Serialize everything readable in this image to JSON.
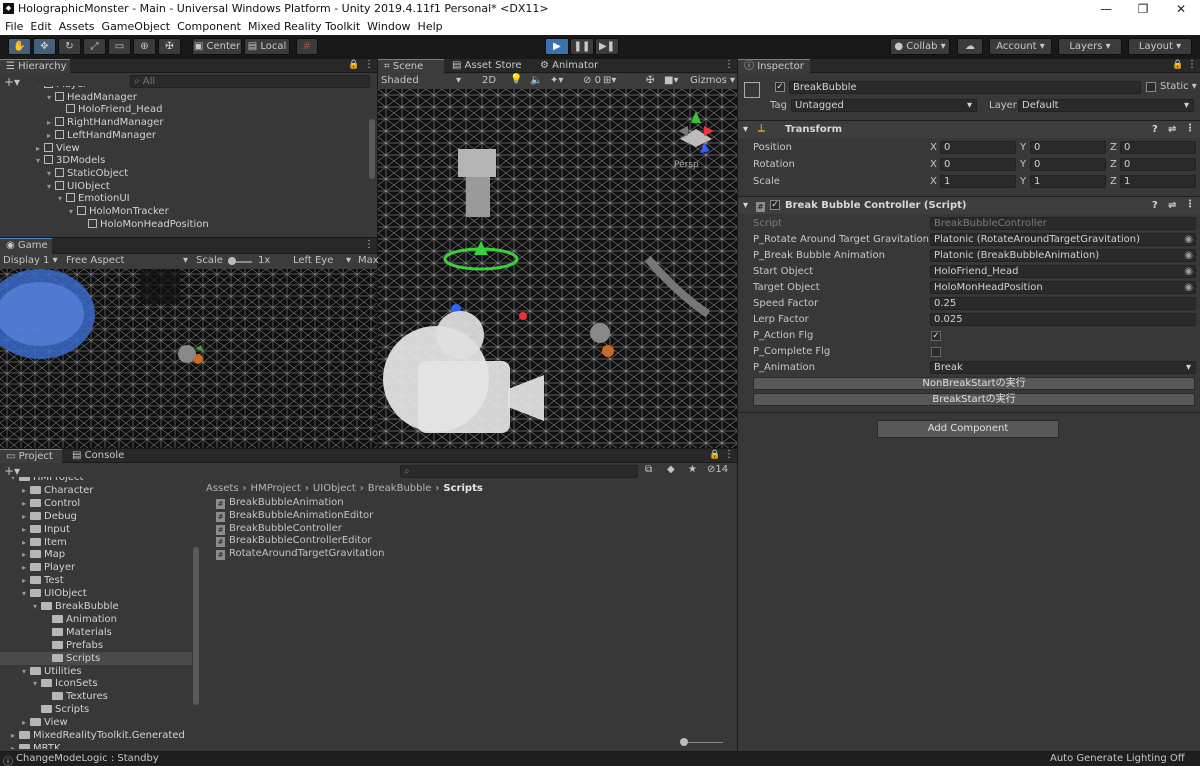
{
  "window": {
    "title": "HolographicMonster - Main - Universal Windows Platform - Unity 2019.4.11f1 Personal* <DX11>",
    "icon": "unity-icon"
  },
  "menu": [
    "File",
    "Edit",
    "Assets",
    "GameObject",
    "Component",
    "Mixed Reality Toolkit",
    "Window",
    "Help"
  ],
  "toolbar": {
    "center": "Center",
    "local": "Local",
    "collab": "Collab",
    "account": "Account",
    "layers": "Layers",
    "layout": "Layout"
  },
  "hierarchy": {
    "title": "Hierarchy",
    "search_placeholder": "All",
    "items": [
      {
        "label": "Player",
        "indent": 2
      },
      {
        "label": "HeadManager",
        "indent": 3
      },
      {
        "label": "HoloFriend_Head",
        "indent": 4
      },
      {
        "label": "RightHandManager",
        "indent": 3
      },
      {
        "label": "LeftHandManager",
        "indent": 3
      },
      {
        "label": "View",
        "indent": 2
      },
      {
        "label": "3DModels",
        "indent": 2
      },
      {
        "label": "StaticObject",
        "indent": 3
      },
      {
        "label": "UIObject",
        "indent": 3
      },
      {
        "label": "EmotionUI",
        "indent": 4
      },
      {
        "label": "HoloMonTracker",
        "indent": 5
      },
      {
        "label": "HoloMonHeadPosition",
        "indent": 6
      }
    ]
  },
  "game": {
    "title": "Game",
    "display": "Display 1",
    "aspect": "Free Aspect",
    "scale_label": "Scale",
    "scale_value": "1x",
    "eye": "Left Eye",
    "max": "Max"
  },
  "scene": {
    "tabs": [
      "Scene",
      "Asset Store",
      "Animator"
    ],
    "shading": "Shaded",
    "mode2d": "2D",
    "gizmos": "Gizmos",
    "persp": "Persp",
    "hidden_count": "0"
  },
  "project": {
    "tabs": [
      "Project",
      "Console"
    ],
    "hidden_count": "14",
    "breadcrumb": [
      "Assets",
      "HMProject",
      "UIObject",
      "BreakBubble",
      "Scripts"
    ],
    "tree": [
      {
        "label": "HMProject",
        "indent": 1
      },
      {
        "label": "Character",
        "indent": 2
      },
      {
        "label": "Control",
        "indent": 2
      },
      {
        "label": "Debug",
        "indent": 2
      },
      {
        "label": "Input",
        "indent": 2
      },
      {
        "label": "Item",
        "indent": 2
      },
      {
        "label": "Map",
        "indent": 2
      },
      {
        "label": "Player",
        "indent": 2
      },
      {
        "label": "Test",
        "indent": 2
      },
      {
        "label": "UIObject",
        "indent": 2
      },
      {
        "label": "BreakBubble",
        "indent": 3
      },
      {
        "label": "Animation",
        "indent": 4
      },
      {
        "label": "Materials",
        "indent": 4
      },
      {
        "label": "Prefabs",
        "indent": 4
      },
      {
        "label": "Scripts",
        "indent": 4
      },
      {
        "label": "Utilities",
        "indent": 2
      },
      {
        "label": "IconSets",
        "indent": 3
      },
      {
        "label": "Textures",
        "indent": 4
      },
      {
        "label": "Scripts",
        "indent": 3
      },
      {
        "label": "View",
        "indent": 2
      },
      {
        "label": "MixedRealityToolkit.Generated",
        "indent": 1
      },
      {
        "label": "MRTK",
        "indent": 1
      }
    ],
    "files": [
      "BreakBubbleAnimation",
      "BreakBubbleAnimationEditor",
      "BreakBubbleController",
      "BreakBubbleControllerEditor",
      "RotateAroundTargetGravitation"
    ]
  },
  "inspector": {
    "title": "Inspector",
    "object_name": "BreakBubble",
    "static_label": "Static",
    "tag_label": "Tag",
    "tag_value": "Untagged",
    "layer_label": "Layer",
    "layer_value": "Default",
    "transform": {
      "title": "Transform",
      "rows": [
        {
          "label": "Position",
          "x": "0",
          "y": "0",
          "z": "0"
        },
        {
          "label": "Rotation",
          "x": "0",
          "y": "0",
          "z": "0"
        },
        {
          "label": "Scale",
          "x": "1",
          "y": "1",
          "z": "1"
        }
      ]
    },
    "component": {
      "title": "Break Bubble Controller (Script)",
      "fields": [
        {
          "label": "Script",
          "value": "BreakBubbleController"
        },
        {
          "label": "P_Rotate Around Target Gravitation",
          "value": "Platonic (RotateAroundTargetGravitation)"
        },
        {
          "label": "P_Break Bubble Animation",
          "value": "Platonic (BreakBubbleAnimation)"
        },
        {
          "label": "Start Object",
          "value": "HoloFriend_Head"
        },
        {
          "label": "Target Object",
          "value": "HoloMonHeadPosition"
        },
        {
          "label": "Speed Factor",
          "value": "0.25"
        },
        {
          "label": "Lerp Factor",
          "value": "0.025"
        },
        {
          "label": "P_Action Flg",
          "value": "✓"
        },
        {
          "label": "P_Complete Flg",
          "value": ""
        },
        {
          "label": "P_Animation",
          "value": "Break"
        }
      ],
      "buttons": [
        "NonBreakStartの実行",
        "BreakStartの実行"
      ]
    },
    "add_component": "Add Component"
  },
  "status": {
    "left": "ChangeModeLogic : Standby",
    "right": "Auto Generate Lighting Off"
  },
  "colors": {
    "accent": "#3a72b0",
    "panel": "#383838",
    "dark": "#191919"
  }
}
